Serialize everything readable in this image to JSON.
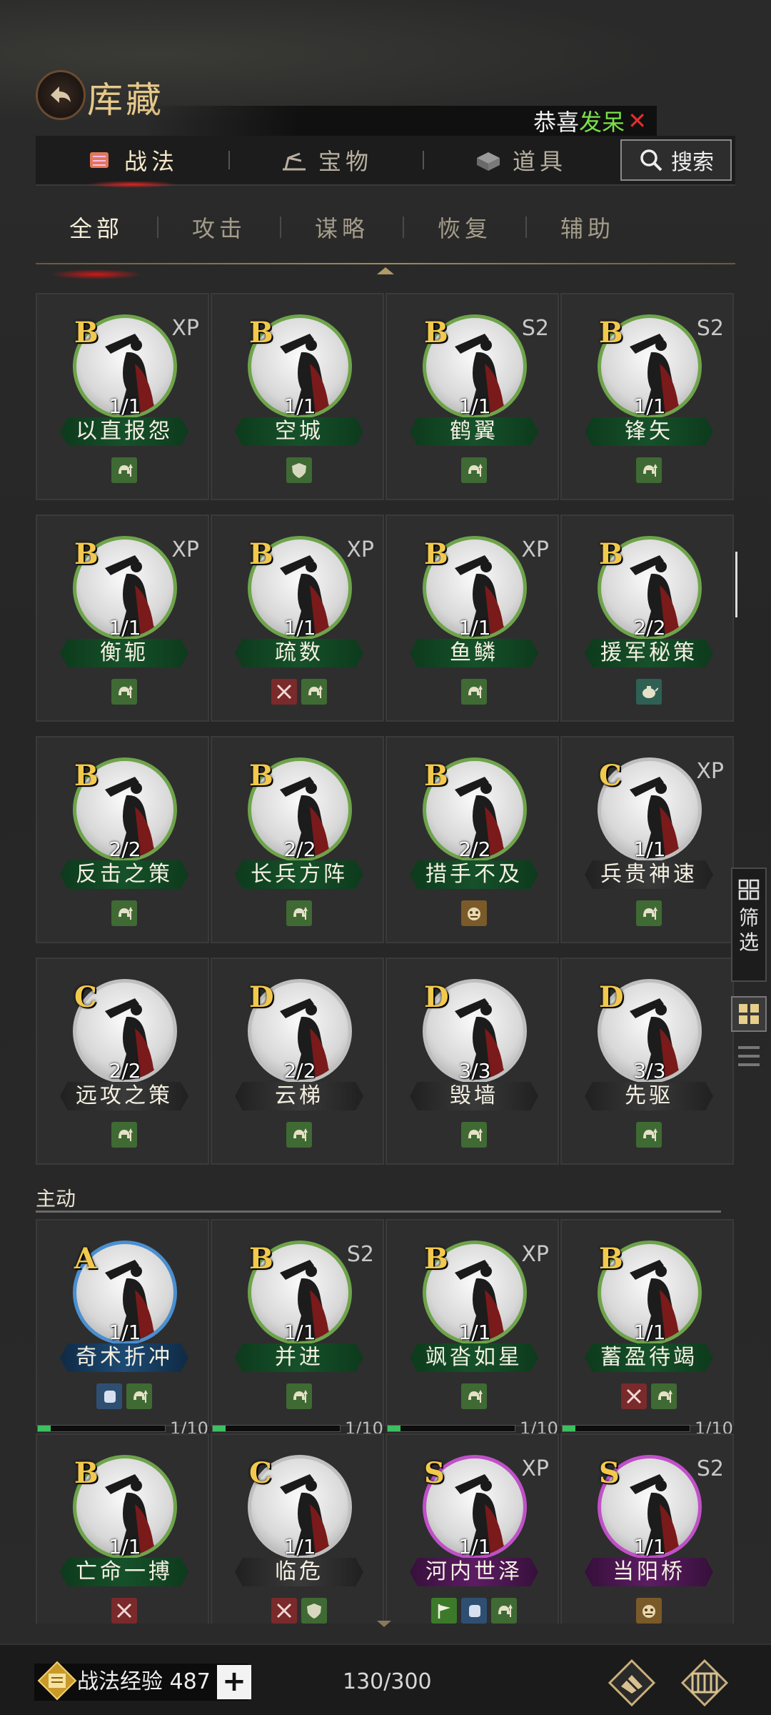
{
  "header": {
    "title": "库藏",
    "notice_text": "恭喜",
    "notice_highlight": "发呆",
    "notice_close": "✕"
  },
  "main_tabs": [
    {
      "label": "战法",
      "active": true
    },
    {
      "label": "宝物",
      "active": false
    },
    {
      "label": "道具",
      "active": false
    }
  ],
  "search": {
    "label": "搜索"
  },
  "sub_tabs": [
    {
      "label": "全部",
      "active": true
    },
    {
      "label": "攻击",
      "active": false
    },
    {
      "label": "谋略",
      "active": false
    },
    {
      "label": "恢复",
      "active": false
    },
    {
      "label": "辅助",
      "active": false
    }
  ],
  "passive_rows": [
    [
      {
        "grade": "B",
        "tag": "XP",
        "count": "1/1",
        "name": "以直报怨",
        "ring": "green",
        "icons": [
          "helmet-up"
        ]
      },
      {
        "grade": "B",
        "tag": "",
        "count": "1/1",
        "name": "空城",
        "ring": "green",
        "icons": [
          "shield"
        ]
      },
      {
        "grade": "B",
        "tag": "S2",
        "count": "1/1",
        "name": "鹤翼",
        "ring": "green",
        "icons": [
          "helmet-up"
        ]
      },
      {
        "grade": "B",
        "tag": "S2",
        "count": "1/1",
        "name": "锋矢",
        "ring": "green",
        "icons": [
          "helmet-up"
        ]
      }
    ],
    [
      {
        "grade": "B",
        "tag": "XP",
        "count": "1/1",
        "name": "衡轭",
        "ring": "green",
        "icons": [
          "helmet-up"
        ]
      },
      {
        "grade": "B",
        "tag": "XP",
        "count": "1/1",
        "name": "疏数",
        "ring": "green",
        "icons": [
          "swords",
          "helmet-up"
        ]
      },
      {
        "grade": "B",
        "tag": "XP",
        "count": "1/1",
        "name": "鱼鳞",
        "ring": "green",
        "icons": [
          "helmet-up"
        ]
      },
      {
        "grade": "B",
        "tag": "",
        "count": "2/2",
        "name": "援军秘策",
        "ring": "green",
        "icons": [
          "teapot"
        ]
      }
    ],
    [
      {
        "grade": "B",
        "tag": "",
        "count": "2/2",
        "name": "反击之策",
        "ring": "green",
        "icons": [
          "helmet-up"
        ]
      },
      {
        "grade": "B",
        "tag": "",
        "count": "2/2",
        "name": "长兵方阵",
        "ring": "green",
        "icons": [
          "helmet-up"
        ]
      },
      {
        "grade": "B",
        "tag": "",
        "count": "2/2",
        "name": "措手不及",
        "ring": "green",
        "icons": [
          "beast"
        ]
      },
      {
        "grade": "C",
        "tag": "XP",
        "count": "1/1",
        "name": "兵贵神速",
        "ring": "grey",
        "icons": [
          "helmet-up"
        ]
      }
    ],
    [
      {
        "grade": "C",
        "tag": "",
        "count": "2/2",
        "name": "远攻之策",
        "ring": "grey",
        "icons": [
          "helmet-up"
        ]
      },
      {
        "grade": "D",
        "tag": "",
        "count": "2/2",
        "name": "云梯",
        "ring": "grey",
        "icons": [
          "helmet-up"
        ]
      },
      {
        "grade": "D",
        "tag": "",
        "count": "3/3",
        "name": "毁墙",
        "ring": "grey",
        "icons": [
          "helmet-up"
        ]
      },
      {
        "grade": "D",
        "tag": "",
        "count": "3/3",
        "name": "先驱",
        "ring": "grey",
        "icons": [
          "helmet-up"
        ]
      }
    ]
  ],
  "active_section": {
    "label": "主动"
  },
  "active_rows": [
    [
      {
        "grade": "A",
        "tag": "",
        "count": "1/1",
        "name": "奇术折冲",
        "ring": "blue",
        "icons": [
          "fist",
          "helmet-up"
        ],
        "progress": "1/10",
        "progress_value": 0.1
      },
      {
        "grade": "B",
        "tag": "S2",
        "count": "1/1",
        "name": "并进",
        "ring": "green",
        "icons": [
          "helmet-up"
        ],
        "progress": "1/10",
        "progress_value": 0.1
      },
      {
        "grade": "B",
        "tag": "XP",
        "count": "1/1",
        "name": "飒沓如星",
        "ring": "green",
        "icons": [
          "helmet-up"
        ],
        "progress": "1/10",
        "progress_value": 0.1
      },
      {
        "grade": "B",
        "tag": "",
        "count": "1/1",
        "name": "蓄盈待竭",
        "ring": "green",
        "icons": [
          "swords",
          "helmet-up"
        ],
        "progress": "1/10",
        "progress_value": 0.1
      }
    ],
    [
      {
        "grade": "B",
        "tag": "",
        "count": "1/1",
        "name": "亡命一搏",
        "ring": "green",
        "icons": [
          "swords"
        ]
      },
      {
        "grade": "C",
        "tag": "",
        "count": "1/1",
        "name": "临危",
        "ring": "grey",
        "icons": [
          "swords",
          "shield"
        ]
      },
      {
        "grade": "S",
        "tag": "XP",
        "count": "1/1",
        "name": "河内世泽",
        "ring": "purple",
        "icons": [
          "flag",
          "fist",
          "helmet-up"
        ]
      },
      {
        "grade": "S",
        "tag": "S2",
        "count": "1/1",
        "name": "当阳桥",
        "ring": "purple",
        "icons": [
          "beast"
        ]
      }
    ]
  ],
  "side": {
    "filter_label_1": "筛",
    "filter_label_2": "选"
  },
  "bottom": {
    "exp_label": "战法经验 487",
    "plus": "+",
    "capacity": "130/300"
  },
  "colors": {
    "grade": "#f2c94c",
    "ring_green": "#6ea44a",
    "ring_grey": "#bfbfbf",
    "ring_blue": "#4a8fd0",
    "ring_purple": "#c050c8",
    "notice_highlight": "#7be04a",
    "notice_close": "#e03030"
  }
}
